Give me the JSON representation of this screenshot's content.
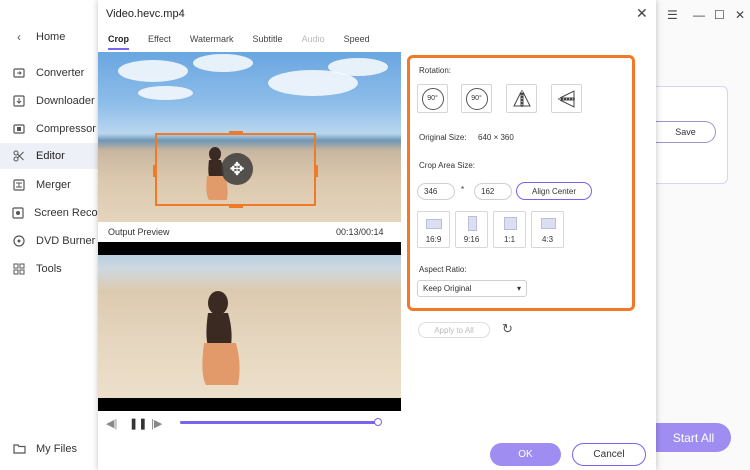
{
  "sidebar": {
    "home": "Home",
    "items": [
      {
        "label": "Converter",
        "icon": "converter-icon"
      },
      {
        "label": "Downloader",
        "icon": "downloader-icon"
      },
      {
        "label": "Compressor",
        "icon": "compressor-icon"
      },
      {
        "label": "Editor",
        "icon": "editor-icon",
        "active": true
      },
      {
        "label": "Merger",
        "icon": "merger-icon"
      },
      {
        "label": "Screen Recorder",
        "icon": "screen-recorder-icon"
      },
      {
        "label": "DVD Burner",
        "icon": "dvd-burner-icon"
      },
      {
        "label": "Tools",
        "icon": "tools-icon"
      }
    ],
    "my_files": "My Files"
  },
  "background": {
    "save_label": "Save",
    "start_all_label": "Start All"
  },
  "dialog": {
    "title": "Video.hevc.mp4",
    "tabs": [
      {
        "label": "Crop",
        "active": true
      },
      {
        "label": "Effect"
      },
      {
        "label": "Watermark"
      },
      {
        "label": "Subtitle"
      },
      {
        "label": "Audio",
        "disabled": true
      },
      {
        "label": "Speed"
      }
    ],
    "output_preview_label": "Output Preview",
    "time": "00:13/00:14",
    "playback_progress": 0.98,
    "rotation_label": "Rotation:",
    "rot_cw_text": "90°",
    "rot_ccw_text": "90°",
    "original_size_label": "Original Size:",
    "original_size_value": "640 × 360",
    "crop_area_label": "Crop Area Size:",
    "crop_width": "346",
    "times_sign": "*",
    "crop_height": "162",
    "align_center": "Align Center",
    "ratios": [
      "16:9",
      "9:16",
      "1:1",
      "4:3"
    ],
    "aspect_ratio_label": "Aspect Ratio:",
    "aspect_ratio_value": "Keep Original",
    "apply_all": "Apply to All",
    "ok": "OK",
    "cancel": "Cancel"
  },
  "colors": {
    "accent": "#7b62f0",
    "highlight": "#f07a27",
    "button_fill": "#9f8df2"
  }
}
